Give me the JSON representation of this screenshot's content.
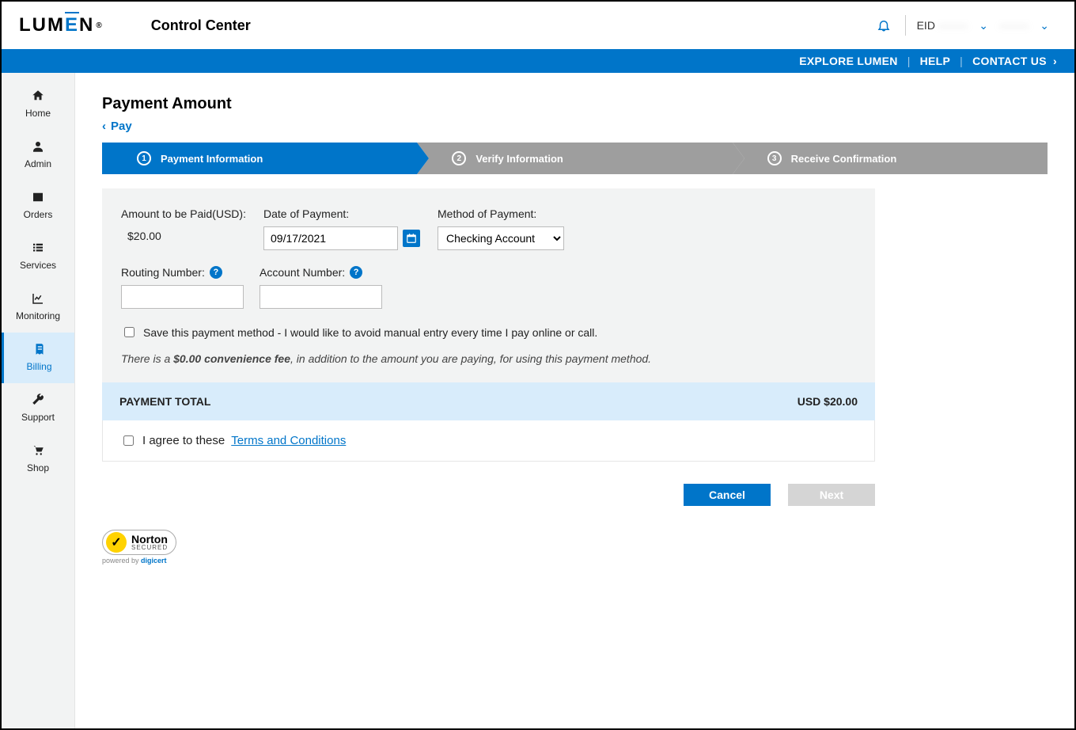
{
  "brand": {
    "name": "LUMEN",
    "app_title": "Control Center"
  },
  "header": {
    "eid_label": "EID",
    "eid_value": "········",
    "user_name": "········",
    "nav": {
      "explore": "EXPLORE LUMEN",
      "help": "HELP",
      "contact": "CONTACT US"
    }
  },
  "sidebar": {
    "items": [
      {
        "key": "home",
        "label": "Home"
      },
      {
        "key": "admin",
        "label": "Admin"
      },
      {
        "key": "orders",
        "label": "Orders"
      },
      {
        "key": "services",
        "label": "Services"
      },
      {
        "key": "monitoring",
        "label": "Monitoring"
      },
      {
        "key": "billing",
        "label": "Billing"
      },
      {
        "key": "support",
        "label": "Support"
      },
      {
        "key": "shop",
        "label": "Shop"
      }
    ]
  },
  "page": {
    "title": "Payment Amount",
    "back_label": "Pay",
    "steps": [
      {
        "label": "Payment Information"
      },
      {
        "label": "Verify Information"
      },
      {
        "label": "Receive Confirmation"
      }
    ]
  },
  "form": {
    "amount_label": "Amount to be Paid(USD):",
    "amount_value": "$20.00",
    "date_label": "Date of Payment:",
    "date_value": "09/17/2021",
    "method_label": "Method of Payment:",
    "method_value": "Checking Account",
    "routing_label": "Routing Number:",
    "routing_value": "",
    "account_label": "Account Number:",
    "account_value": "",
    "save_label": "Save this payment method - I would like to avoid manual entry every time I pay online or call.",
    "fee_prefix": "There is a ",
    "fee_bold": "$0.00 convenience fee",
    "fee_suffix": ", in addition to the amount you are paying, for using this payment method.",
    "total_label": "PAYMENT TOTAL",
    "total_value": "USD $20.00",
    "agree_text": "I agree to these ",
    "terms_link": "Terms and Conditions",
    "cancel": "Cancel",
    "next": "Next"
  },
  "seal": {
    "brand": "Norton",
    "tag": "SECURED",
    "powered_prefix": "powered by ",
    "powered_brand": "digicert"
  }
}
